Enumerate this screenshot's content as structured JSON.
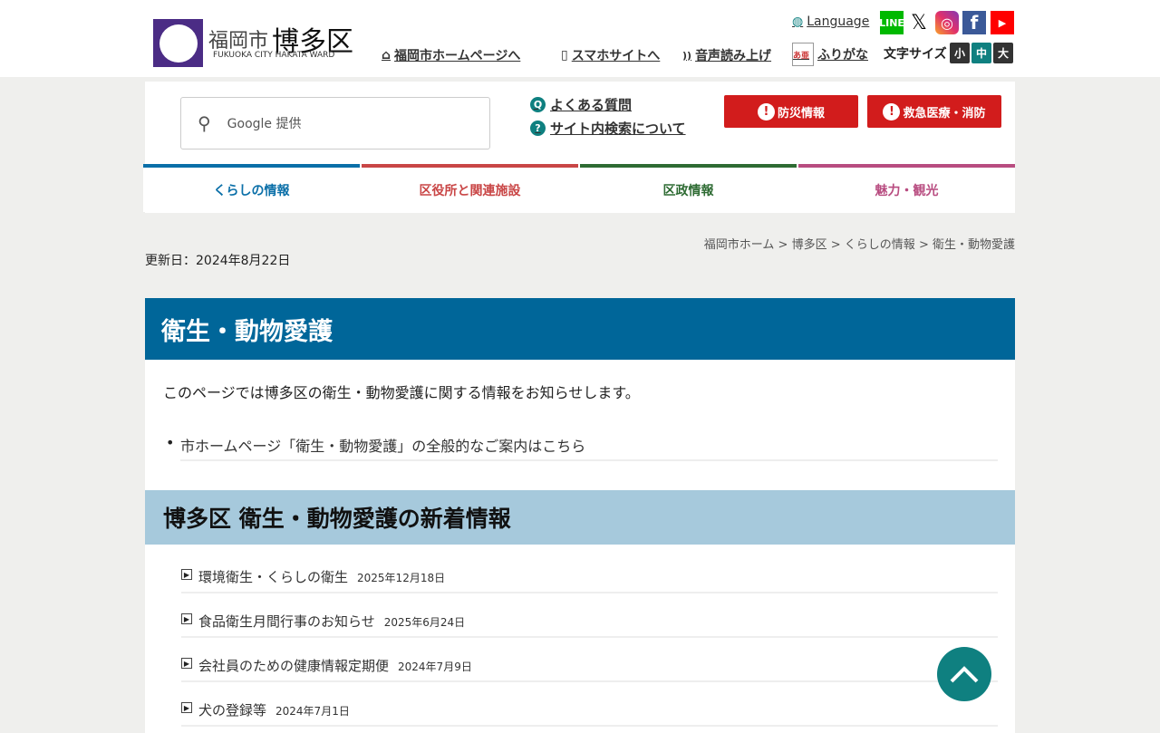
{
  "header": {
    "logo_city": "福岡市",
    "logo_ward": "博多区",
    "logo_en": "FUKUOKA CITY HAKATA WARD",
    "home_link": "福岡市ホームページへ",
    "smartphone_link": "スマホサイトへ",
    "speech_link": "音声読み上げ",
    "furigana_link": "ふりがな",
    "furigana_icon": "あ亜",
    "language_link": "Language",
    "social": [
      {
        "name": "LINE",
        "color": "#00b900",
        "label": "LINE"
      },
      {
        "name": "X",
        "color": "#ffffff",
        "label": "𝕏"
      },
      {
        "name": "Instagram",
        "color": "#d6249f",
        "label": "◎"
      },
      {
        "name": "Facebook",
        "color": "#3b5998",
        "label": "f"
      },
      {
        "name": "YouTube",
        "color": "#ff0000",
        "label": "▶"
      }
    ],
    "font_size_label": "文字サイズ",
    "font_sizes": [
      "小",
      "中",
      "大"
    ]
  },
  "search": {
    "placeholder": "Google 提供"
  },
  "quick_links": [
    {
      "icon": "Q",
      "label": "よくある質問"
    },
    {
      "icon": "?",
      "label": "サイト内検索について"
    }
  ],
  "alert_buttons": [
    "防災情報",
    "救急医療・消防"
  ],
  "nav": [
    {
      "label": "くらしの情報",
      "color": "#0a6fa8"
    },
    {
      "label": "区役所と関連施設",
      "color": "#c94646"
    },
    {
      "label": "区政情報",
      "color": "#2e6b33"
    },
    {
      "label": "魅力・観光",
      "color": "#b84c80"
    }
  ],
  "breadcrumb": [
    "福岡市ホーム",
    "博多区",
    "くらしの情報",
    "衛生・動物愛護"
  ],
  "breadcrumb_sep": ">",
  "updated": "更新日：2024年8月22日",
  "page_title": "衛生・動物愛護",
  "intro": "このページでは博多区の衛生・動物愛護に関する情報をお知らせします。",
  "city_link": "市ホームページ「衛生・動物愛護」の全般的なご案内はこちら",
  "news_heading": "博多区 衛生・動物愛護の新着情報",
  "news": [
    {
      "title": "環境衛生・くらしの衛生",
      "date": "2025年12月18日"
    },
    {
      "title": "食品衛生月間行事のお知らせ",
      "date": "2025年6月24日"
    },
    {
      "title": "会社員のための健康情報定期便",
      "date": "2024年7月9日"
    },
    {
      "title": "犬の登録等",
      "date": "2024年7月1日"
    }
  ]
}
